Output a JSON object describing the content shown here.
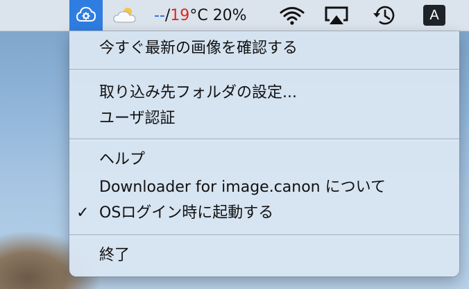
{
  "menubar": {
    "app_icon": "cloud-download-gear-icon",
    "weather_icon": "partly-cloudy-icon",
    "temp_low": "--",
    "temp_sep": "/",
    "temp_high": "19",
    "temp_unit": " °C",
    "battery": "20%",
    "wifi_icon": "wifi-icon",
    "airplay_icon": "airplay-icon",
    "timemachine_icon": "time-machine-icon",
    "input_source": "A"
  },
  "menu": {
    "check_now": "今すぐ最新の画像を確認する",
    "destination": "取り込み先フォルダの設定...",
    "user_auth": "ユーザ認証",
    "help": "ヘルプ",
    "about": "Downloader for image.canon について",
    "launch_at_login": "OSログイン時に起動する",
    "launch_at_login_checked": true,
    "check_mark": "✓",
    "quit": "終了"
  },
  "colors": {
    "accent": "#2f7de1",
    "temp_low": "#1f63d6",
    "temp_high": "#e0261d"
  }
}
